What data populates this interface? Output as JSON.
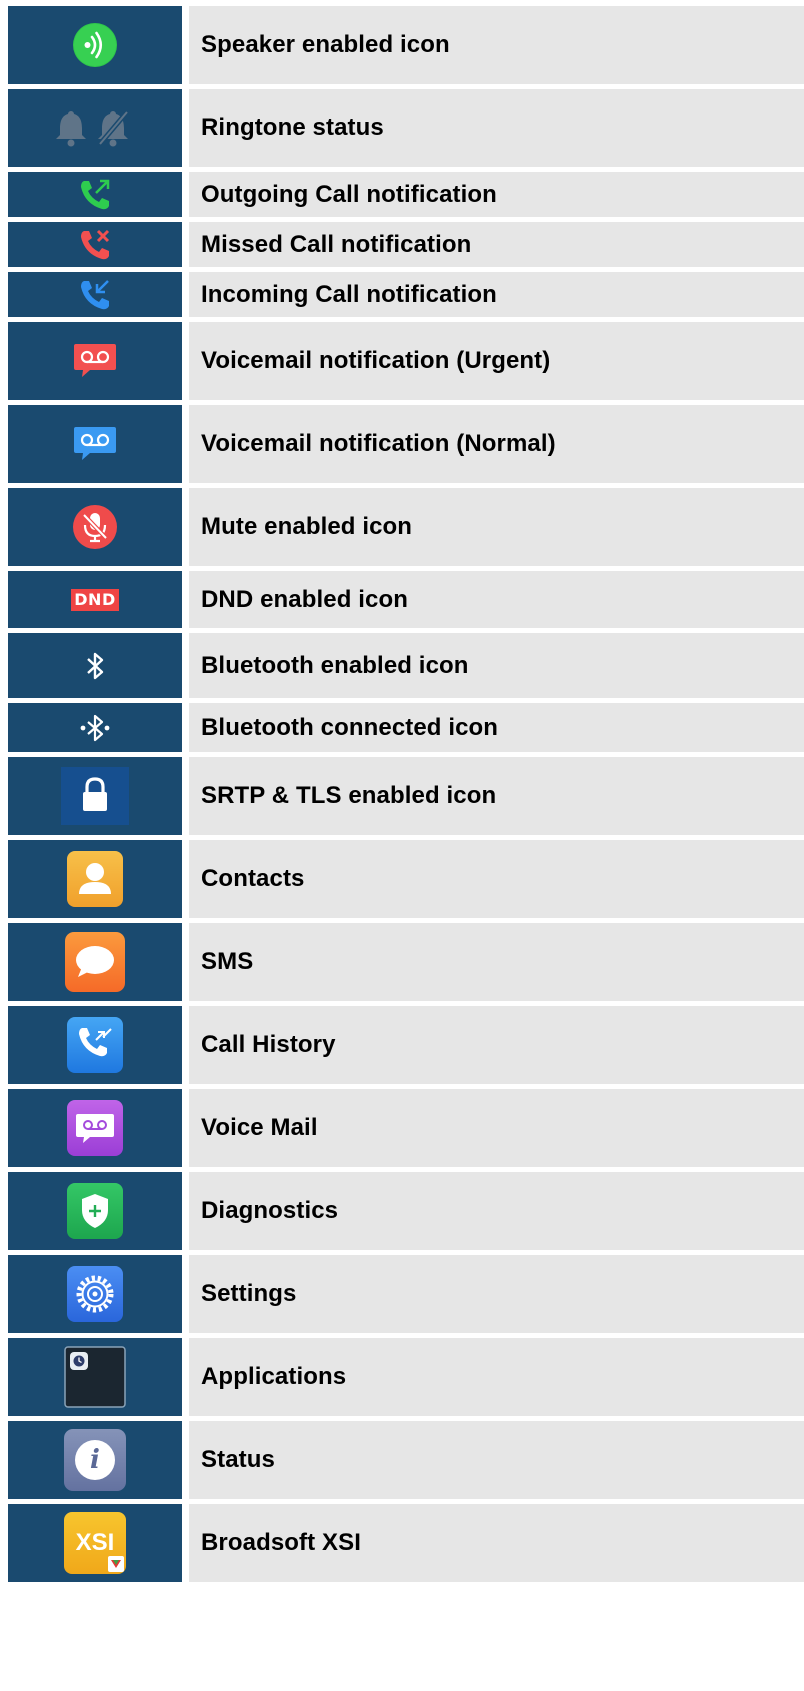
{
  "rows": [
    {
      "label": "Speaker enabled icon",
      "icon": "speaker-icon"
    },
    {
      "label": "Ringtone status",
      "icon": "bell-icon"
    },
    {
      "label": "Outgoing Call notification",
      "icon": "outgoing-call-icon"
    },
    {
      "label": "Missed Call notification",
      "icon": "missed-call-icon"
    },
    {
      "label": "Incoming Call notification",
      "icon": "incoming-call-icon"
    },
    {
      "label": "Voicemail notification (Urgent)",
      "icon": "voicemail-urgent-icon"
    },
    {
      "label": "Voicemail notification (Normal)",
      "icon": "voicemail-normal-icon"
    },
    {
      "label": "Mute enabled icon",
      "icon": "mute-icon"
    },
    {
      "label": "DND enabled icon",
      "icon": "dnd-icon",
      "icon_text": "DND"
    },
    {
      "label": "Bluetooth enabled icon",
      "icon": "bluetooth-icon"
    },
    {
      "label": "Bluetooth connected icon",
      "icon": "bluetooth-connected-icon"
    },
    {
      "label": "SRTP & TLS enabled icon",
      "icon": "lock-icon"
    },
    {
      "label": "Contacts",
      "icon": "contacts-icon"
    },
    {
      "label": "SMS",
      "icon": "sms-icon"
    },
    {
      "label": "Call History",
      "icon": "call-history-icon"
    },
    {
      "label": "Voice Mail",
      "icon": "voice-mail-icon"
    },
    {
      "label": "Diagnostics",
      "icon": "diagnostics-icon"
    },
    {
      "label": "Settings",
      "icon": "settings-icon"
    },
    {
      "label": "Applications",
      "icon": "applications-icon"
    },
    {
      "label": "Status",
      "icon": "status-icon",
      "icon_text": "i"
    },
    {
      "label": "Broadsoft XSI",
      "icon": "broadsoft-xsi-icon",
      "icon_text": "XSI"
    }
  ],
  "colors": {
    "icon_cell_bg": "#1a4a6f",
    "text_cell_bg": "#e6e6e6"
  }
}
